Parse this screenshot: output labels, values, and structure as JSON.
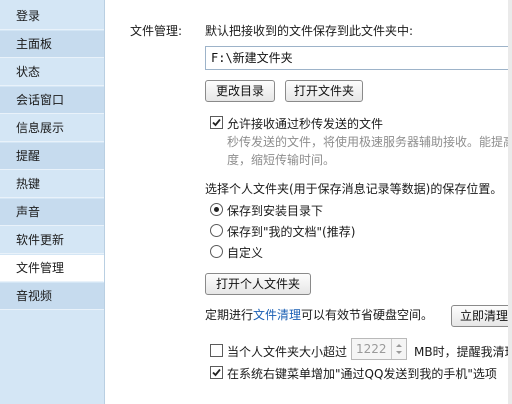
{
  "sidebar": {
    "items": [
      {
        "label": "登录"
      },
      {
        "label": "主面板"
      },
      {
        "label": "状态"
      },
      {
        "label": "会话窗口"
      },
      {
        "label": "信息展示"
      },
      {
        "label": "提醒"
      },
      {
        "label": "热键"
      },
      {
        "label": "声音"
      },
      {
        "label": "软件更新"
      },
      {
        "label": "文件管理"
      },
      {
        "label": "音视频"
      }
    ],
    "active_index": 9
  },
  "file_mgmt": {
    "section_label": "文件管理:",
    "default_save_desc": "默认把接收到的文件保存到此文件夹中:",
    "folder_path": "F:\\新建文件夹",
    "change_dir_button": "更改目录",
    "open_folder_button": "打开文件夹",
    "secure_transfer_label": "允许接收通过秒传发送的文件",
    "secure_transfer_checked": true,
    "secure_transfer_desc_line1": "秒传发送的文件，将使用极速服务器辅助接收。能提高",
    "secure_transfer_desc_line2": "度，缩短传输时间。",
    "personal_folder_desc": "选择个人文件夹(用于保存消息记录等数据)的保存位置。",
    "radio_options": [
      {
        "label": "保存到安装目录下"
      },
      {
        "label": "保存到\"我的文档\"(推荐)"
      },
      {
        "label": "自定义"
      }
    ],
    "radio_selected": 0,
    "open_personal_button": "打开个人文件夹",
    "cleanup_prefix": "定期进行",
    "cleanup_link": "文件清理",
    "cleanup_suffix": "可以有效节省硬盘空间。",
    "cleanup_now_button": "立即清理",
    "size_limit_label": "当个人文件夹大小超过",
    "size_limit_checked": false,
    "size_limit_value": "1222",
    "size_limit_unit": "MB时，提醒我清理",
    "context_menu_label": "在系统右键菜单增加\"通过QQ发送到我的手机\"选项",
    "context_menu_checked": true
  },
  "colors": {
    "sidebar_bg": "#d4e6f5",
    "link": "#1a5fb4"
  }
}
